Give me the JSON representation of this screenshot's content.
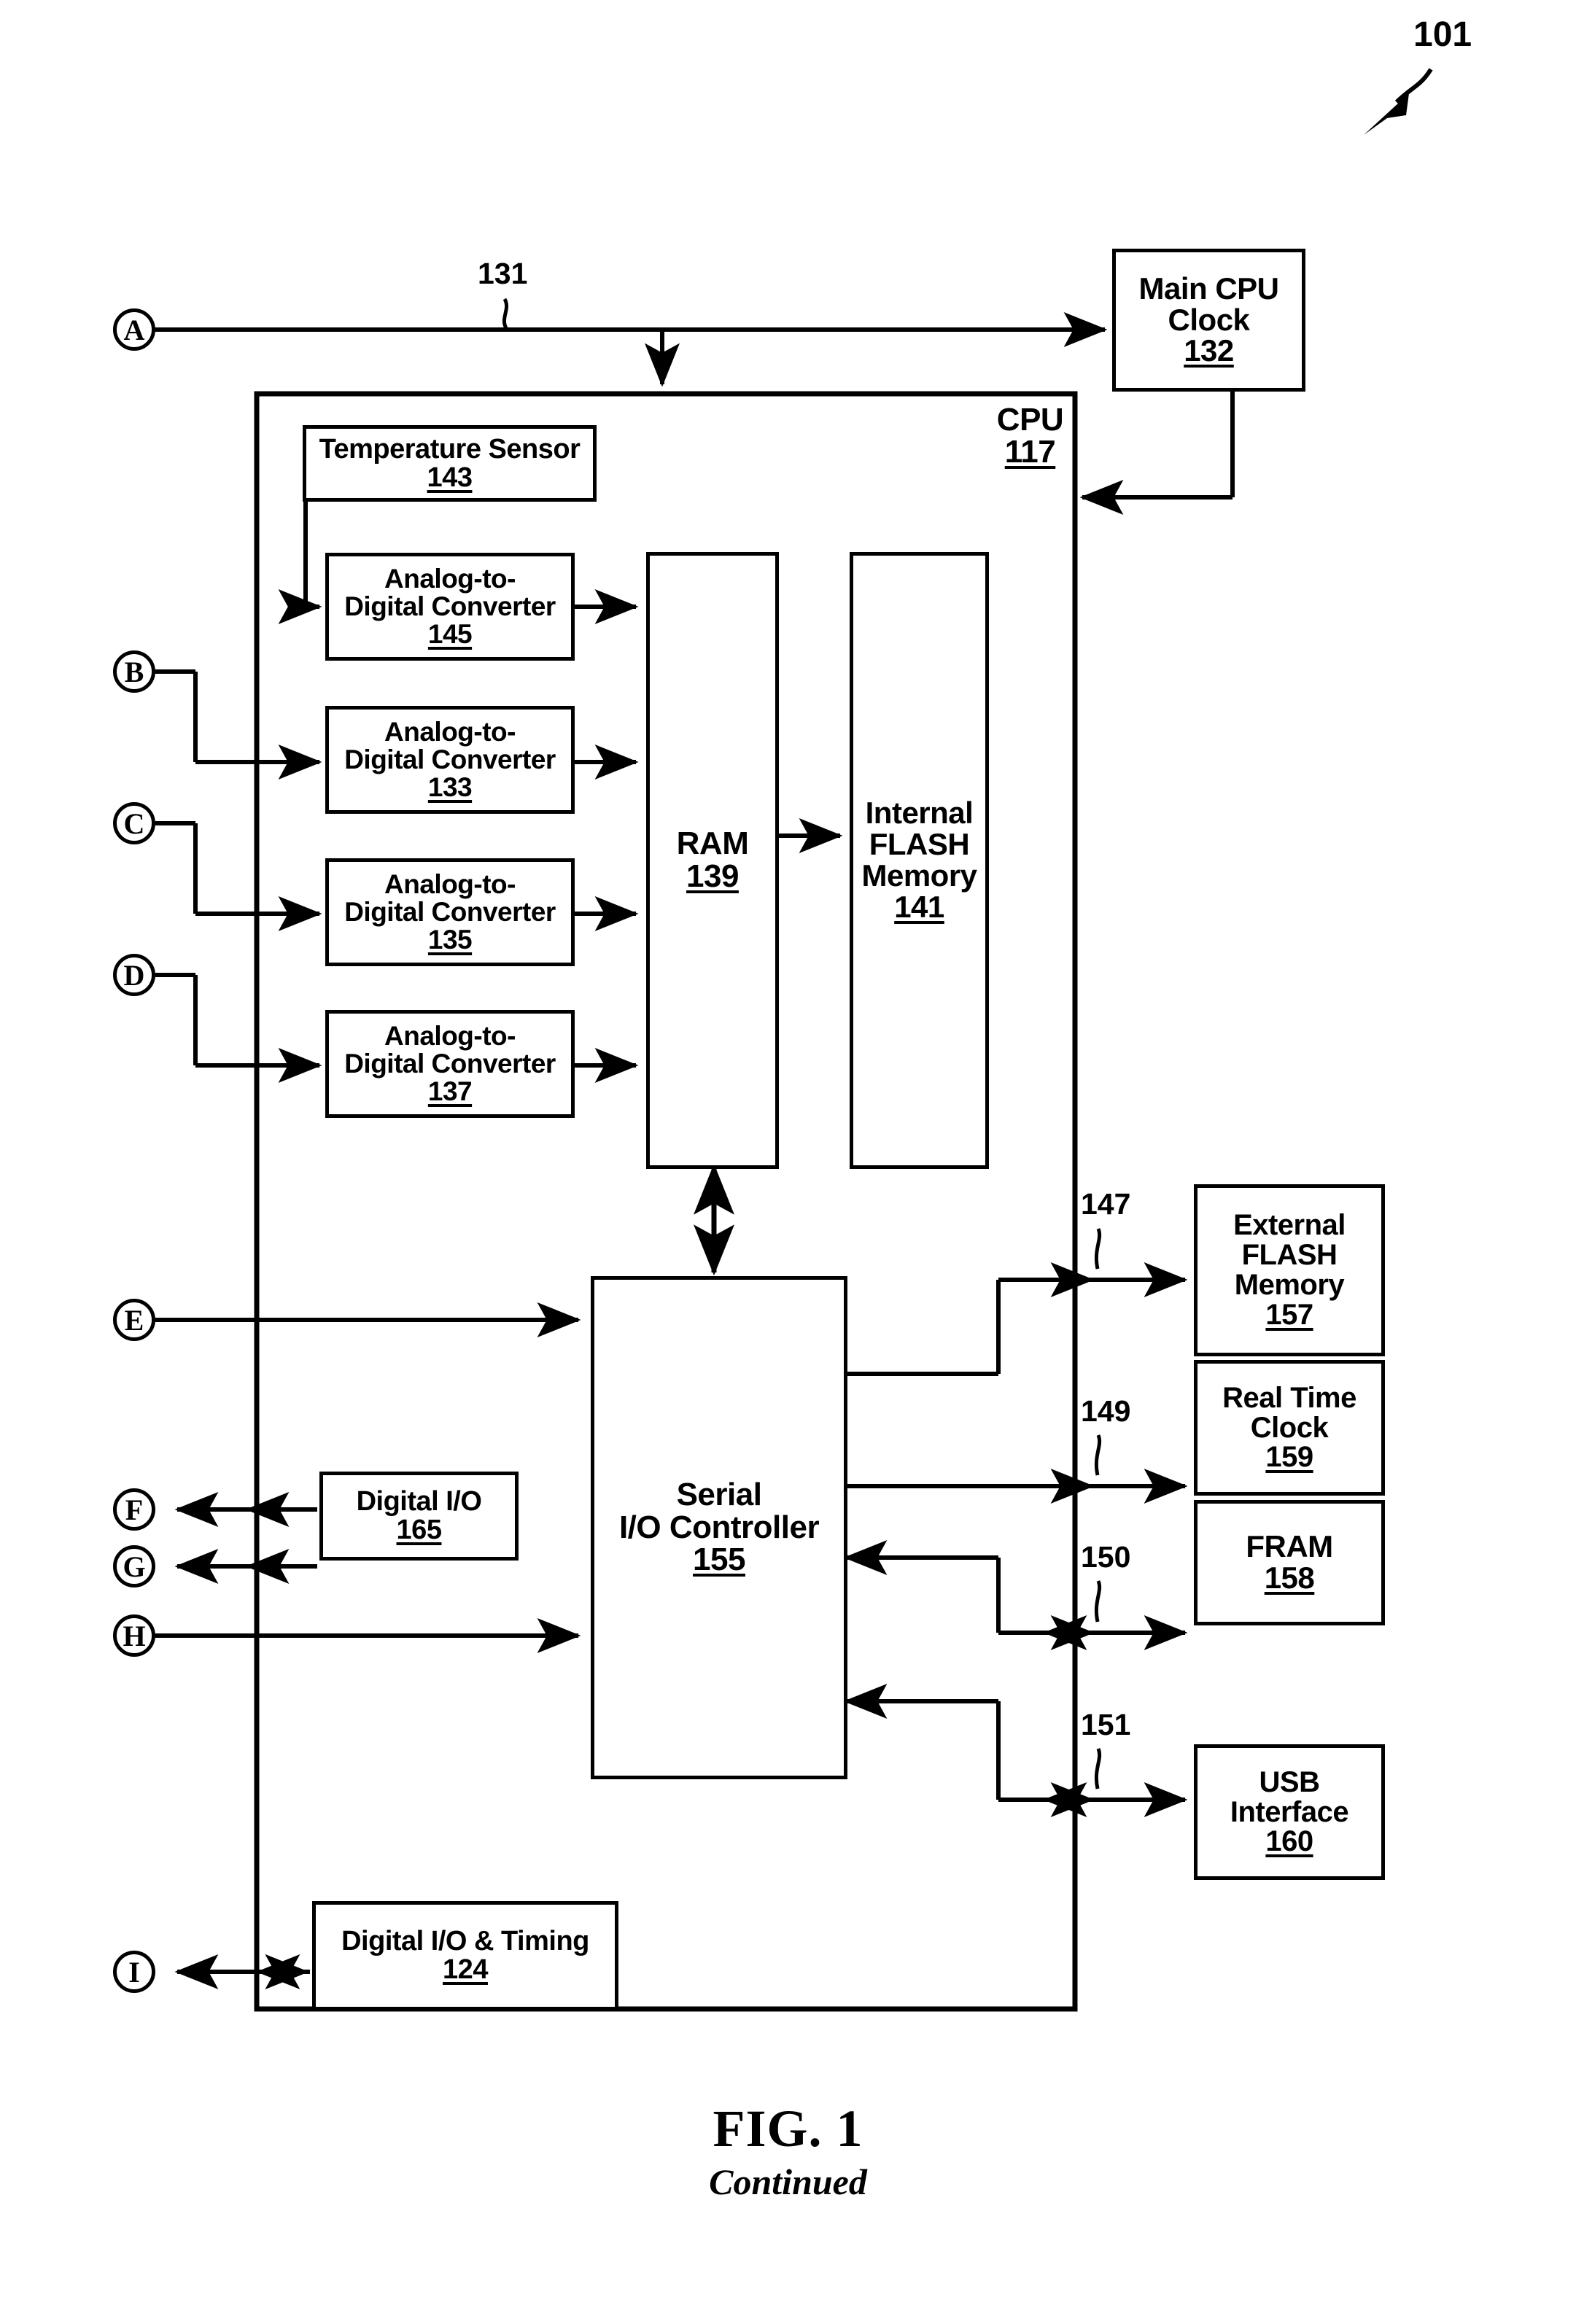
{
  "figure": {
    "top_reference": "101",
    "caption_main": "FIG. 1",
    "caption_sub": "Continued"
  },
  "cpu": {
    "label": "CPU",
    "number": "117"
  },
  "connector_labels": [
    {
      "id": "A",
      "text": "A"
    },
    {
      "id": "B",
      "text": "B"
    },
    {
      "id": "C",
      "text": "C"
    },
    {
      "id": "D",
      "text": "D"
    },
    {
      "id": "E",
      "text": "E"
    },
    {
      "id": "F",
      "text": "F"
    },
    {
      "id": "G",
      "text": "G"
    },
    {
      "id": "H",
      "text": "H"
    },
    {
      "id": "I",
      "text": "I"
    }
  ],
  "line_references": [
    {
      "id": "131",
      "text": "131"
    },
    {
      "id": "147",
      "text": "147"
    },
    {
      "id": "149",
      "text": "149"
    },
    {
      "id": "150",
      "text": "150"
    },
    {
      "id": "151",
      "text": "151"
    }
  ],
  "blocks": [
    {
      "id": "main-cpu-clock",
      "title": "Main CPU\nClock",
      "number": "132"
    },
    {
      "id": "temperature-sensor",
      "title": "Temperature Sensor",
      "number": "143"
    },
    {
      "id": "adc-145",
      "title": "Analog-to-\nDigital Converter",
      "number": "145"
    },
    {
      "id": "adc-133",
      "title": "Analog-to-\nDigital Converter",
      "number": "133"
    },
    {
      "id": "adc-135",
      "title": "Analog-to-\nDigital Converter",
      "number": "135"
    },
    {
      "id": "adc-137",
      "title": "Analog-to-\nDigital Converter",
      "number": "137"
    },
    {
      "id": "ram",
      "title": "RAM",
      "number": "139"
    },
    {
      "id": "internal-flash-memory",
      "title": "Internal\nFLASH\nMemory",
      "number": "141"
    },
    {
      "id": "serial-io-controller",
      "title": "Serial\nI/O Controller",
      "number": "155"
    },
    {
      "id": "digital-io",
      "title": "Digital I/O",
      "number": "165"
    },
    {
      "id": "digital-io-timing",
      "title": "Digital I/O & Timing",
      "number": "124"
    },
    {
      "id": "external-flash-memory",
      "title": "External\nFLASH\nMemory",
      "number": "157"
    },
    {
      "id": "real-time-clock",
      "title": "Real Time\nClock",
      "number": "159"
    },
    {
      "id": "fram",
      "title": "FRAM",
      "number": "158"
    },
    {
      "id": "usb-interface",
      "title": "USB\nInterface",
      "number": "160"
    }
  ]
}
